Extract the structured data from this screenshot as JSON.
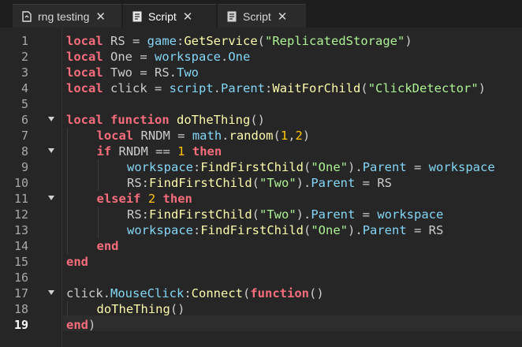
{
  "tabs": [
    {
      "label": "rng testing",
      "icon": "place-file-icon",
      "close": "✕",
      "active": false
    },
    {
      "label": "Script",
      "icon": "script-icon",
      "close": "✕",
      "active": true
    },
    {
      "label": "Script",
      "icon": "script-icon",
      "close": "✕",
      "active": false
    }
  ],
  "editor": {
    "current_line": 19,
    "lines": [
      {
        "n": "1",
        "tokens": [
          [
            "kw",
            "local"
          ],
          [
            "plain",
            " RS = "
          ],
          [
            "bi",
            "game"
          ],
          [
            "plain",
            ":"
          ],
          [
            "fn",
            "GetService"
          ],
          [
            "plain",
            "("
          ],
          [
            "str",
            "\"ReplicatedStorage\""
          ],
          [
            "plain",
            ")"
          ]
        ]
      },
      {
        "n": "2",
        "tokens": [
          [
            "kw",
            "local"
          ],
          [
            "plain",
            " One = "
          ],
          [
            "bi",
            "workspace"
          ],
          [
            "plain",
            "."
          ],
          [
            "bi",
            "One"
          ]
        ]
      },
      {
        "n": "3",
        "tokens": [
          [
            "kw",
            "local"
          ],
          [
            "plain",
            " Two = RS."
          ],
          [
            "bi",
            "Two"
          ]
        ]
      },
      {
        "n": "4",
        "tokens": [
          [
            "kw",
            "local"
          ],
          [
            "plain",
            " click = "
          ],
          [
            "bi",
            "script"
          ],
          [
            "plain",
            "."
          ],
          [
            "bi",
            "Parent"
          ],
          [
            "plain",
            ":"
          ],
          [
            "fn",
            "WaitForChild"
          ],
          [
            "plain",
            "("
          ],
          [
            "str",
            "\"ClickDetector\""
          ],
          [
            "plain",
            ")"
          ]
        ]
      },
      {
        "n": "5",
        "tokens": []
      },
      {
        "n": "6",
        "fold": true,
        "tokens": [
          [
            "kw",
            "local"
          ],
          [
            "plain",
            " "
          ],
          [
            "kw",
            "function"
          ],
          [
            "plain",
            " "
          ],
          [
            "fn",
            "doTheThing"
          ],
          [
            "plain",
            "()"
          ]
        ]
      },
      {
        "n": "7",
        "indent": 1,
        "tokens": [
          [
            "kw",
            "local"
          ],
          [
            "plain",
            " RNDM = "
          ],
          [
            "bi",
            "math"
          ],
          [
            "plain",
            "."
          ],
          [
            "fn",
            "random"
          ],
          [
            "plain",
            "("
          ],
          [
            "num",
            "1"
          ],
          [
            "plain",
            ","
          ],
          [
            "num",
            "2"
          ],
          [
            "plain",
            ")"
          ]
        ]
      },
      {
        "n": "8",
        "indent": 1,
        "fold": true,
        "tokens": [
          [
            "kw",
            "if"
          ],
          [
            "plain",
            " RNDM == "
          ],
          [
            "num",
            "1"
          ],
          [
            "plain",
            " "
          ],
          [
            "kw",
            "then"
          ]
        ]
      },
      {
        "n": "9",
        "indent": 2,
        "tokens": [
          [
            "bi",
            "workspace"
          ],
          [
            "plain",
            ":"
          ],
          [
            "fn",
            "FindFirstChild"
          ],
          [
            "plain",
            "("
          ],
          [
            "str",
            "\"One\""
          ],
          [
            "plain",
            ")."
          ],
          [
            "bi",
            "Parent"
          ],
          [
            "plain",
            " = "
          ],
          [
            "bi",
            "workspace"
          ]
        ]
      },
      {
        "n": "10",
        "indent": 2,
        "tokens": [
          [
            "plain",
            "RS:"
          ],
          [
            "fn",
            "FindFirstChild"
          ],
          [
            "plain",
            "("
          ],
          [
            "str",
            "\"Two\""
          ],
          [
            "plain",
            ")."
          ],
          [
            "bi",
            "Parent"
          ],
          [
            "plain",
            " = RS"
          ]
        ]
      },
      {
        "n": "11",
        "indent": 1,
        "fold": true,
        "tokens": [
          [
            "kw",
            "elseif"
          ],
          [
            "plain",
            " "
          ],
          [
            "num",
            "2"
          ],
          [
            "plain",
            " "
          ],
          [
            "kw",
            "then"
          ]
        ]
      },
      {
        "n": "12",
        "indent": 2,
        "tokens": [
          [
            "plain",
            "RS:"
          ],
          [
            "fn",
            "FindFirstChild"
          ],
          [
            "plain",
            "("
          ],
          [
            "str",
            "\"Two\""
          ],
          [
            "plain",
            ")."
          ],
          [
            "bi",
            "Parent"
          ],
          [
            "plain",
            " = "
          ],
          [
            "bi",
            "workspace"
          ]
        ]
      },
      {
        "n": "13",
        "indent": 2,
        "tokens": [
          [
            "bi",
            "workspace"
          ],
          [
            "plain",
            ":"
          ],
          [
            "fn",
            "FindFirstChild"
          ],
          [
            "plain",
            "("
          ],
          [
            "str",
            "\"One\""
          ],
          [
            "plain",
            ")."
          ],
          [
            "bi",
            "Parent"
          ],
          [
            "plain",
            " = RS"
          ]
        ]
      },
      {
        "n": "14",
        "indent": 1,
        "tokens": [
          [
            "kw",
            "end"
          ]
        ]
      },
      {
        "n": "15",
        "tokens": [
          [
            "kw",
            "end"
          ]
        ]
      },
      {
        "n": "16",
        "tokens": []
      },
      {
        "n": "17",
        "fold": true,
        "tokens": [
          [
            "plain",
            "click."
          ],
          [
            "bi",
            "MouseClick"
          ],
          [
            "plain",
            ":"
          ],
          [
            "fn",
            "Connect"
          ],
          [
            "plain",
            "("
          ],
          [
            "kw",
            "function"
          ],
          [
            "plain",
            "()"
          ]
        ]
      },
      {
        "n": "18",
        "indent": 1,
        "tokens": [
          [
            "fn",
            "doTheThing"
          ],
          [
            "plain",
            "()"
          ]
        ]
      },
      {
        "n": "19",
        "tokens": [
          [
            "kw",
            "end"
          ],
          [
            "plain",
            ")"
          ]
        ]
      }
    ]
  }
}
